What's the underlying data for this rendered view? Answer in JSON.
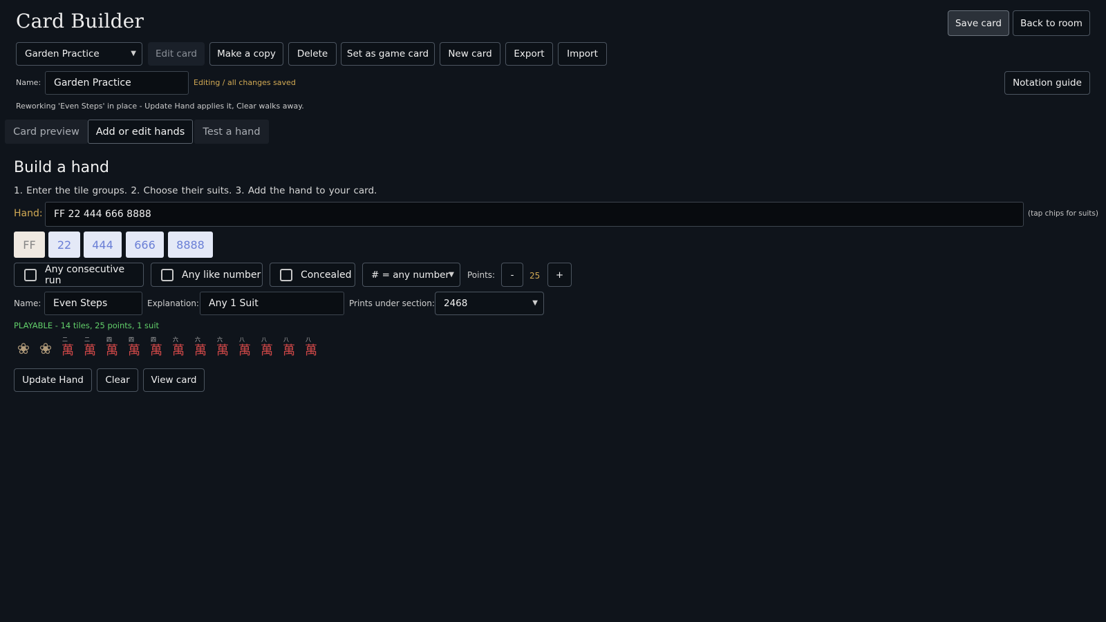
{
  "app": {
    "title": "Card Builder"
  },
  "header": {
    "save_label": "Save card",
    "back_label": "Back to room"
  },
  "toolbar": {
    "card_select": "Garden Practice",
    "edit_label": "Edit card",
    "copy_label": "Make a copy",
    "delete_label": "Delete",
    "set_game_label": "Set as game card",
    "new_label": "New card",
    "export_label": "Export",
    "import_label": "Import"
  },
  "card": {
    "name_label": "Name:",
    "name_value": "Garden Practice",
    "status": "Editing / all changes saved",
    "notation_label": "Notation guide",
    "rework_note": "Reworking 'Even Steps' in place - Update Hand applies it, Clear walks away."
  },
  "tabs": [
    {
      "label": "Card preview",
      "active": false
    },
    {
      "label": "Add or edit hands",
      "active": true
    },
    {
      "label": "Test a hand",
      "active": false
    }
  ],
  "builder": {
    "heading": "Build a hand",
    "steps": "1. Enter the tile groups.   2. Choose their suits.   3. Add the hand to your card.",
    "hand_label": "Hand:",
    "hand_value": "FF 22 444 666 8888",
    "hint": "(tap chips for suits)",
    "chips": [
      {
        "label": "FF",
        "kind": "flower"
      },
      {
        "label": "22",
        "kind": "num"
      },
      {
        "label": "444",
        "kind": "num"
      },
      {
        "label": "666",
        "kind": "num"
      },
      {
        "label": "8888",
        "kind": "num"
      }
    ],
    "options": {
      "consecutive": "Any consecutive run",
      "like_number": "Any like number",
      "concealed": "Concealed",
      "number_select": "# = any number",
      "points_label": "Points:",
      "points_value": "25",
      "minus": "-",
      "plus": "+"
    },
    "meta": {
      "name_label": "Name:",
      "name_value": "Even Steps",
      "explanation_label": "Explanation:",
      "explanation_value": "Any 1 Suit",
      "section_label": "Prints under section:",
      "section_value": "2468"
    },
    "status": "PLAYABLE - 14 tiles, 25 points, 1 suit",
    "tiles": [
      {
        "num": "",
        "glyph": "❀",
        "kind": "flower"
      },
      {
        "num": "",
        "glyph": "❀",
        "kind": "flower"
      },
      {
        "num": "二",
        "glyph": "萬",
        "kind": "char"
      },
      {
        "num": "二",
        "glyph": "萬",
        "kind": "char"
      },
      {
        "num": "四",
        "glyph": "萬",
        "kind": "char"
      },
      {
        "num": "四",
        "glyph": "萬",
        "kind": "char"
      },
      {
        "num": "四",
        "glyph": "萬",
        "kind": "char"
      },
      {
        "num": "六",
        "glyph": "萬",
        "kind": "char"
      },
      {
        "num": "六",
        "glyph": "萬",
        "kind": "char"
      },
      {
        "num": "六",
        "glyph": "萬",
        "kind": "char"
      },
      {
        "num": "八",
        "glyph": "萬",
        "kind": "char"
      },
      {
        "num": "八",
        "glyph": "萬",
        "kind": "char"
      },
      {
        "num": "八",
        "glyph": "萬",
        "kind": "char"
      },
      {
        "num": "八",
        "glyph": "萬",
        "kind": "char"
      }
    ],
    "actions": {
      "update": "Update Hand",
      "clear": "Clear",
      "view": "View card"
    }
  }
}
